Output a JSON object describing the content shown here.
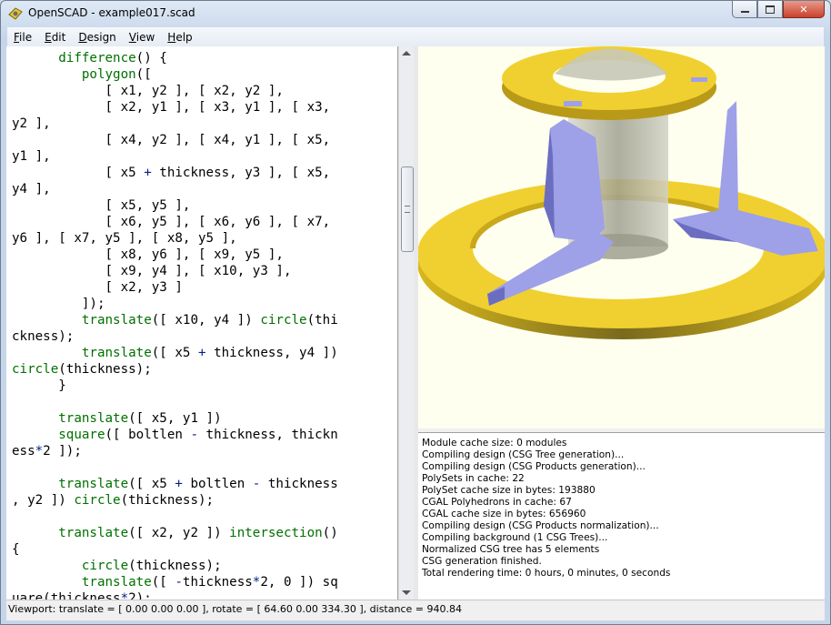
{
  "window": {
    "title": "OpenSCAD - example017.scad"
  },
  "menubar": [
    {
      "key": "F",
      "rest": "ile"
    },
    {
      "key": "E",
      "rest": "dit"
    },
    {
      "key": "D",
      "rest": "esign"
    },
    {
      "key": "V",
      "rest": "iew"
    },
    {
      "key": "H",
      "rest": "elp"
    }
  ],
  "editor": {
    "lines": [
      [
        [
          "",
          "      "
        ],
        [
          "kw",
          "difference"
        ],
        [
          "",
          "() {"
        ]
      ],
      [
        [
          "",
          "         "
        ],
        [
          "kw",
          "polygon"
        ],
        [
          "",
          "(["
        ]
      ],
      [
        [
          "",
          "            [ x1, y2 ], [ x2, y2 ],"
        ]
      ],
      [
        [
          "",
          "            [ x2, y1 ], [ x3, y1 ], [ x3,"
        ]
      ],
      [
        [
          "",
          "y2 ],"
        ]
      ],
      [
        [
          "",
          "            [ x4, y2 ], [ x4, y1 ], [ x5,"
        ]
      ],
      [
        [
          "",
          "y1 ],"
        ]
      ],
      [
        [
          "",
          "            [ x5 "
        ],
        [
          "fn",
          "+"
        ],
        [
          "",
          " thickness, y3 ], [ x5,"
        ]
      ],
      [
        [
          "",
          "y4 ],"
        ]
      ],
      [
        [
          "",
          "            [ x5, y5 ],"
        ]
      ],
      [
        [
          "",
          "            [ x6, y5 ], [ x6, y6 ], [ x7,"
        ]
      ],
      [
        [
          "",
          "y6 ], [ x7, y5 ], [ x8, y5 ],"
        ]
      ],
      [
        [
          "",
          "            [ x8, y6 ], [ x9, y5 ],"
        ]
      ],
      [
        [
          "",
          "            [ x9, y4 ], [ x10, y3 ],"
        ]
      ],
      [
        [
          "",
          "            [ x2, y3 ]"
        ]
      ],
      [
        [
          "",
          "         ]);"
        ]
      ],
      [
        [
          "",
          "         "
        ],
        [
          "kw",
          "translate"
        ],
        [
          "",
          "([ x10, y4 ]) "
        ],
        [
          "kw",
          "circle"
        ],
        [
          "",
          "(thi"
        ]
      ],
      [
        [
          "",
          "ckness);"
        ]
      ],
      [
        [
          "",
          "         "
        ],
        [
          "kw",
          "translate"
        ],
        [
          "",
          "([ x5 "
        ],
        [
          "fn",
          "+"
        ],
        [
          "",
          " thickness, y4 ])"
        ]
      ],
      [
        [
          "kw",
          "circle"
        ],
        [
          "",
          "(thickness);"
        ]
      ],
      [
        [
          "",
          "      }"
        ]
      ],
      [
        [
          "",
          ""
        ]
      ],
      [
        [
          "",
          "      "
        ],
        [
          "kw",
          "translate"
        ],
        [
          "",
          "([ x5, y1 ])"
        ]
      ],
      [
        [
          "",
          "      "
        ],
        [
          "kw",
          "square"
        ],
        [
          "",
          "([ boltlen "
        ],
        [
          "fn",
          "-"
        ],
        [
          "",
          " thickness, thickn"
        ]
      ],
      [
        [
          "",
          "ess"
        ],
        [
          "fn",
          "*"
        ],
        [
          "",
          "2 ]);"
        ]
      ],
      [
        [
          "",
          ""
        ]
      ],
      [
        [
          "",
          "      "
        ],
        [
          "kw",
          "translate"
        ],
        [
          "",
          "([ x5 "
        ],
        [
          "fn",
          "+"
        ],
        [
          "",
          " boltlen "
        ],
        [
          "fn",
          "-"
        ],
        [
          "",
          " thickness"
        ]
      ],
      [
        [
          "",
          ", y2 ]) "
        ],
        [
          "kw",
          "circle"
        ],
        [
          "",
          "(thickness);"
        ]
      ],
      [
        [
          "",
          ""
        ]
      ],
      [
        [
          "",
          "      "
        ],
        [
          "kw",
          "translate"
        ],
        [
          "",
          "([ x2, y2 ]) "
        ],
        [
          "kw",
          "intersection"
        ],
        [
          "",
          "()"
        ]
      ],
      [
        [
          "",
          "{"
        ]
      ],
      [
        [
          "",
          "         "
        ],
        [
          "kw",
          "circle"
        ],
        [
          "",
          "(thickness);"
        ]
      ],
      [
        [
          "",
          "         "
        ],
        [
          "kw",
          "translate"
        ],
        [
          "",
          "([ "
        ],
        [
          "fn",
          "-"
        ],
        [
          "",
          "thickness"
        ],
        [
          "fn",
          "*"
        ],
        [
          "",
          "2, 0 ]) sq"
        ]
      ],
      [
        [
          "",
          "uare(thickness"
        ],
        [
          "fn",
          "*"
        ],
        [
          "",
          "2);"
        ]
      ]
    ]
  },
  "console": {
    "lines": [
      "Module cache size: 0 modules",
      "Compiling design (CSG Tree generation)...",
      "Compiling design (CSG Products generation)...",
      "PolySets in cache: 22",
      "PolySet cache size in bytes: 193880",
      "CGAL Polyhedrons in cache: 67",
      "CGAL cache size in bytes: 656960",
      "Compiling design (CSG Products normalization)...",
      "Compiling background (1 CSG Trees)...",
      "Normalized CSG tree has 5 elements",
      "CSG generation finished.",
      "Total rendering time: 0 hours, 0 minutes, 0 seconds"
    ]
  },
  "statusbar": {
    "text": "Viewport: translate = [ 0.00 0.00 0.00 ], rotate = [ 64.60 0.00 334.30 ], distance = 940.84"
  },
  "colors": {
    "ring": "#f0d030",
    "bracket": "#9ea0e8",
    "viewport_bg": "#fffff0",
    "keyword": "#007000"
  },
  "icons": {
    "app": "openscad-icon",
    "minimize": "minimize-icon",
    "maximize": "maximize-icon",
    "close": "close-icon"
  }
}
